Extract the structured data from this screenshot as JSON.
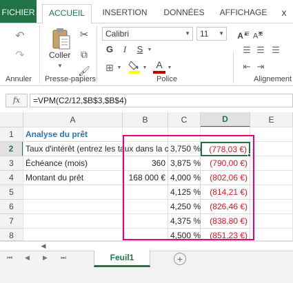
{
  "tabs": [
    "FICHIER",
    "ACCUEIL",
    "INSERTION",
    "DONNÉES",
    "AFFICHAGE"
  ],
  "close_glyph": "x",
  "ribbon": {
    "groups": {
      "annuler": "Annuler",
      "presse_papiers": "Presse-papiers",
      "police": "Police",
      "alignement": "Alignement"
    },
    "coller_label": "Coller",
    "font_name": "Calibri",
    "font_size": "11",
    "bold": "G",
    "italic": "I",
    "underline": "S",
    "font_color_letter": "A",
    "highlight_color": "#ffff00",
    "font_color": "#c00000"
  },
  "formula_bar": {
    "fx": "fx",
    "formula": "=VPM(C2/12,$B$3,$B$4)"
  },
  "columns": [
    "A",
    "B",
    "C",
    "D",
    "E"
  ],
  "rows": [
    "1",
    "2",
    "3",
    "4",
    "5",
    "6",
    "7",
    "8"
  ],
  "cells": {
    "A1": "Analyse du prêt",
    "A2": "Taux d'intérêt (entrez les taux dans la c",
    "A3": "Échéance (mois)",
    "A4": "Montant du prêt",
    "B3": "360",
    "B4": "168 000 €",
    "C2": "3,750 %",
    "C3": "3,875 %",
    "C4": "4,000 %",
    "C5": "4,125 %",
    "C6": "4,250 %",
    "C7": "4,375 %",
    "C8": "4,500 %",
    "D2": "(778,03 €)",
    "D3": "(790,00 €)",
    "D4": "(802,06 €)",
    "D5": "(814,21 €)",
    "D6": "(826,46 €)",
    "D7": "(838,80 €)",
    "D8": "(851,23 €)"
  },
  "sheet_tab": "Feuil1",
  "colors": {
    "excel_green": "#217346",
    "negative": "#e81123",
    "highlight_box": "#e5007e",
    "header_selected": "#217346"
  }
}
